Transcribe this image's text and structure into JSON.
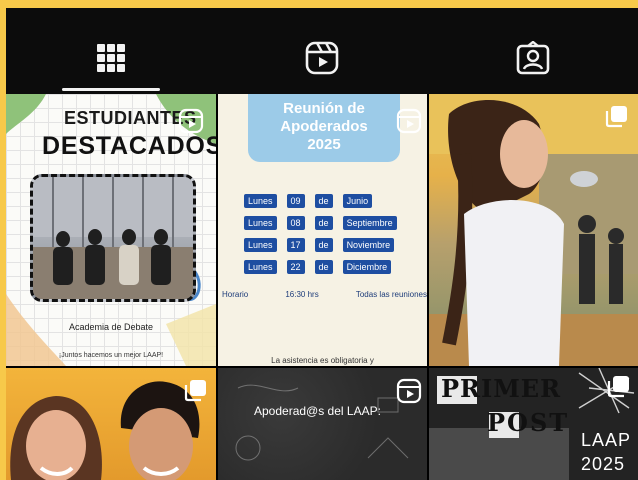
{
  "colors": {
    "outer_border": "#f7c94a",
    "tabbar_bg": "#0c0c0c",
    "tab_icon": "#f2f2f2",
    "pill_blue": "#1e4ea1",
    "header_blue": "#9ccbe8"
  },
  "tabs": [
    {
      "name": "posts-grid",
      "icon": "grid-icon",
      "active": true
    },
    {
      "name": "reels",
      "icon": "reels-icon",
      "active": false
    },
    {
      "name": "tagged",
      "icon": "tagged-person-icon",
      "active": false
    }
  ],
  "posts": {
    "destacados": {
      "title_line1": "ESTUDIANTES",
      "title_line2": "DESTACADOS",
      "subtitle": "Academia de Debate",
      "footer": "¡Juntos hacemos un mejor LAAP!",
      "badge_icon": "reel-icon"
    },
    "reunion": {
      "title_line1": "Reunión de",
      "title_line2": "Apoderados",
      "title_line3": "2025",
      "dates": [
        {
          "day_label": "Lunes",
          "day": "09",
          "connector": "de",
          "month": "Junio"
        },
        {
          "day_label": "Lunes",
          "day": "08",
          "connector": "de",
          "month": "Septiembre"
        },
        {
          "day_label": "Lunes",
          "day": "17",
          "connector": "de",
          "month": "Noviembre"
        },
        {
          "day_label": "Lunes",
          "day": "22",
          "connector": "de",
          "month": "Diciembre"
        }
      ],
      "schedule_label": "Horario",
      "schedule_time": "16:30 hrs",
      "schedule_note": "Todas las reuniones",
      "attendance_note": "La asistencia es obligatoria y",
      "badge_icon": "reel-icon"
    },
    "photo_girl": {
      "badge_icon": "multiple-images-icon"
    },
    "photo_couple": {
      "badge_icon": "multiple-images-icon"
    },
    "apoderados": {
      "text": "Apoderad@s del LAAP:",
      "badge_icon": "reel-icon"
    },
    "primer_post": {
      "line1": "PRIMER",
      "line2": "POST",
      "line3": "LAAP",
      "line4": "2025",
      "badge_icon": "multiple-images-icon"
    }
  }
}
